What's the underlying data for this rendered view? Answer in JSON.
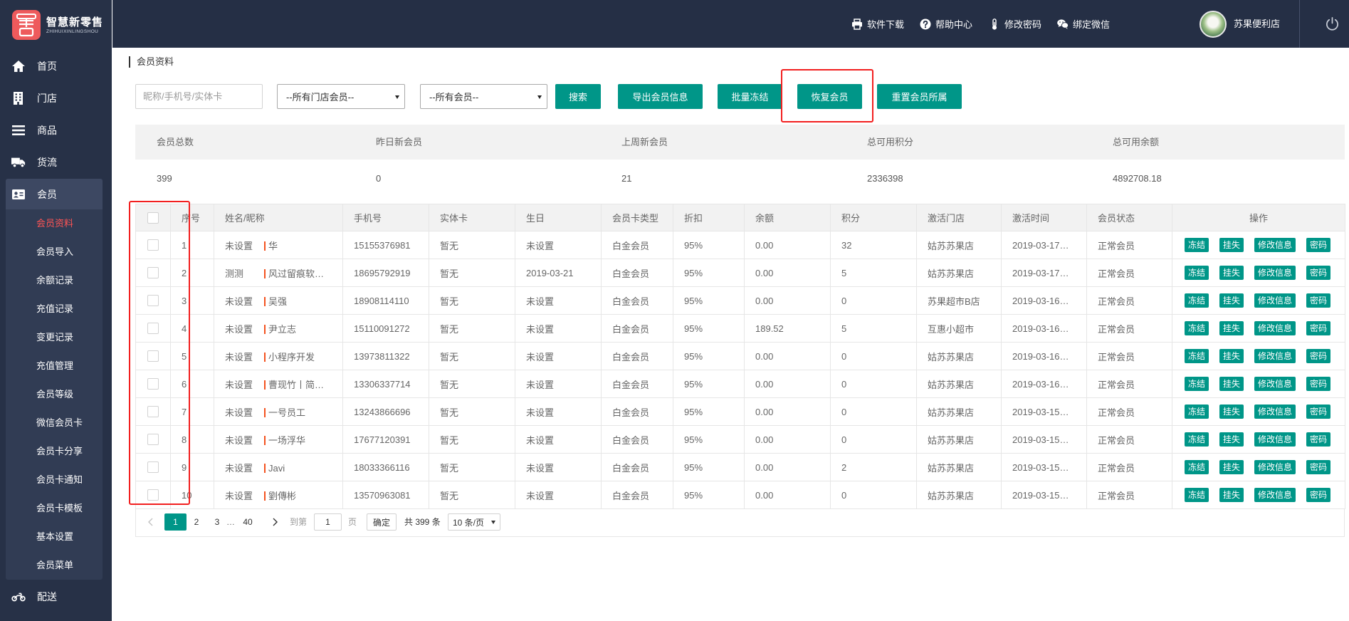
{
  "app": {
    "logo_title": "智慧新零售",
    "logo_subtitle": "ZHIHUIXINLINGSHOU"
  },
  "header": {
    "links": [
      {
        "label": "软件下载",
        "icon": "printer-icon"
      },
      {
        "label": "帮助中心",
        "icon": "question-circle-icon"
      },
      {
        "label": "修改密码",
        "icon": "thermometer-icon"
      },
      {
        "label": "绑定微信",
        "icon": "wechat-icon"
      }
    ],
    "user_name": "苏果便利店",
    "logout_icon": "power-icon"
  },
  "sidebar": {
    "items": [
      {
        "label": "首页",
        "icon": "home-icon"
      },
      {
        "label": "门店",
        "icon": "store-icon"
      },
      {
        "label": "商品",
        "icon": "list-icon"
      },
      {
        "label": "货流",
        "icon": "truck-icon"
      },
      {
        "label": "会员",
        "icon": "id-card-icon",
        "expanded": true
      },
      {
        "label": "配送",
        "icon": "motorcycle-icon"
      }
    ],
    "member_submenu": [
      {
        "label": "会员资料",
        "active": true
      },
      {
        "label": "会员导入"
      },
      {
        "label": "余额记录"
      },
      {
        "label": "充值记录"
      },
      {
        "label": "变更记录"
      },
      {
        "label": "充值管理"
      },
      {
        "label": "会员等级"
      },
      {
        "label": "微信会员卡"
      },
      {
        "label": "会员卡分享"
      },
      {
        "label": "会员卡通知"
      },
      {
        "label": "会员卡模板"
      },
      {
        "label": "基本设置"
      },
      {
        "label": "会员菜单"
      }
    ]
  },
  "breadcrumb": "会员资料",
  "filters": {
    "search_placeholder": "昵称/手机号/实体卡",
    "store_select": "--所有门店会员--",
    "member_select": "--所有会员--"
  },
  "buttons": {
    "search": "搜索",
    "export": "导出会员信息",
    "batch_freeze": "批量冻结",
    "restore": "恢复会员",
    "reset_owner": "重置会员所属"
  },
  "stats": [
    {
      "label": "会员总数",
      "value": "399"
    },
    {
      "label": "昨日新会员",
      "value": "0"
    },
    {
      "label": "上周新会员",
      "value": "21"
    },
    {
      "label": "总可用积分",
      "value": "2336398"
    },
    {
      "label": "总可用余额",
      "value": "4892708.18"
    }
  ],
  "table": {
    "columns": [
      "序号",
      "姓名/昵称",
      "手机号",
      "实体卡",
      "生日",
      "会员卡类型",
      "折扣",
      "余额",
      "积分",
      "激活门店",
      "激活时间",
      "会员状态",
      "操作"
    ],
    "actions": [
      "冻结",
      "挂失",
      "修改信息",
      "密码"
    ],
    "rows": [
      {
        "seq": "1",
        "name": "未设置",
        "nickname": "华",
        "phone": "15155376981",
        "card": "暂无",
        "birthday": "未设置",
        "card_type": "白金会员",
        "discount": "95%",
        "balance": "0.00",
        "points": "32",
        "store": "姑苏苏果店",
        "activated_at": "2019-03-17…",
        "status": "正常会员"
      },
      {
        "seq": "2",
        "name": "测测",
        "nickname": "风过留痕软…",
        "phone": "18695792919",
        "card": "暂无",
        "birthday": "2019-03-21",
        "card_type": "白金会员",
        "discount": "95%",
        "balance": "0.00",
        "points": "5",
        "store": "姑苏苏果店",
        "activated_at": "2019-03-17…",
        "status": "正常会员"
      },
      {
        "seq": "3",
        "name": "未设置",
        "nickname": "吴强",
        "phone": "18908114110",
        "card": "暂无",
        "birthday": "未设置",
        "card_type": "白金会员",
        "discount": "95%",
        "balance": "0.00",
        "points": "0",
        "store": "苏果超市B店",
        "activated_at": "2019-03-16…",
        "status": "正常会员"
      },
      {
        "seq": "4",
        "name": "未设置",
        "nickname": "尹立志",
        "phone": "15110091272",
        "card": "暂无",
        "birthday": "未设置",
        "card_type": "白金会员",
        "discount": "95%",
        "balance": "189.52",
        "points": "5",
        "store": "互惠小超市",
        "activated_at": "2019-03-16…",
        "status": "正常会员"
      },
      {
        "seq": "5",
        "name": "未设置",
        "nickname": "小程序开发",
        "phone": "13973811322",
        "card": "暂无",
        "birthday": "未设置",
        "card_type": "白金会员",
        "discount": "95%",
        "balance": "0.00",
        "points": "0",
        "store": "姑苏苏果店",
        "activated_at": "2019-03-16…",
        "status": "正常会员"
      },
      {
        "seq": "6",
        "name": "未设置",
        "nickname": "曹现竹丨简…",
        "phone": "13306337714",
        "card": "暂无",
        "birthday": "未设置",
        "card_type": "白金会员",
        "discount": "95%",
        "balance": "0.00",
        "points": "0",
        "store": "姑苏苏果店",
        "activated_at": "2019-03-16…",
        "status": "正常会员"
      },
      {
        "seq": "7",
        "name": "未设置",
        "nickname": "一号员工",
        "phone": "13243866696",
        "card": "暂无",
        "birthday": "未设置",
        "card_type": "白金会员",
        "discount": "95%",
        "balance": "0.00",
        "points": "0",
        "store": "姑苏苏果店",
        "activated_at": "2019-03-15…",
        "status": "正常会员"
      },
      {
        "seq": "8",
        "name": "未设置",
        "nickname": "一场浮华",
        "phone": "17677120391",
        "card": "暂无",
        "birthday": "未设置",
        "card_type": "白金会员",
        "discount": "95%",
        "balance": "0.00",
        "points": "0",
        "store": "姑苏苏果店",
        "activated_at": "2019-03-15…",
        "status": "正常会员"
      },
      {
        "seq": "9",
        "name": "未设置",
        "nickname": "Javi",
        "phone": "18033366116",
        "card": "暂无",
        "birthday": "未设置",
        "card_type": "白金会员",
        "discount": "95%",
        "balance": "0.00",
        "points": "2",
        "store": "姑苏苏果店",
        "activated_at": "2019-03-15…",
        "status": "正常会员"
      },
      {
        "seq": "10",
        "name": "未设置",
        "nickname": "劉傳彬",
        "phone": "13570963081",
        "card": "暂无",
        "birthday": "未设置",
        "card_type": "白金会员",
        "discount": "95%",
        "balance": "0.00",
        "points": "0",
        "store": "姑苏苏果店",
        "activated_at": "2019-03-15…",
        "status": "正常会员"
      }
    ]
  },
  "pagination": {
    "pages": [
      "1",
      "2",
      "3",
      "…",
      "40"
    ],
    "current": "1",
    "goto_label": "到第",
    "goto_value": "1",
    "page_unit": "页",
    "confirm": "确定",
    "total": "共 399 条",
    "page_size": "10 条/页"
  },
  "colors": {
    "sidebar_bg": "#273147",
    "header_bg": "#252f45",
    "accent": "#009688",
    "active_menu": "#ff5454",
    "highlight_box": "#f21f1f"
  }
}
